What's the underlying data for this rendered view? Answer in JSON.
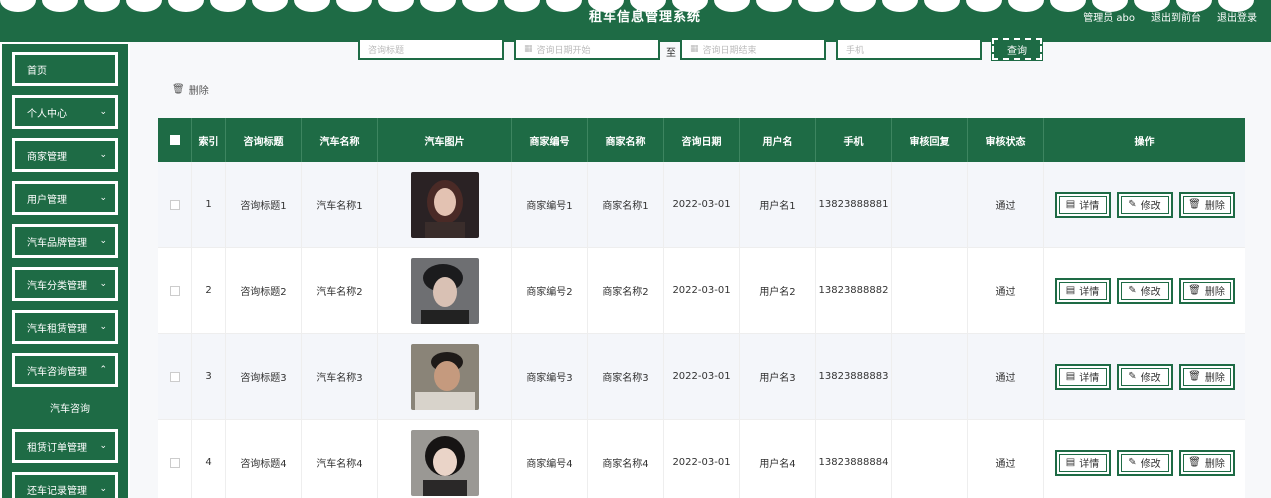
{
  "header": {
    "title": "租车信息管理系统",
    "user": "管理员 abo",
    "exit_front": "退出到前台",
    "logout": "退出登录"
  },
  "sidebar": {
    "items": [
      {
        "label": "首页"
      },
      {
        "label": "个人中心"
      },
      {
        "label": "商家管理"
      },
      {
        "label": "用户管理"
      },
      {
        "label": "汽车品牌管理"
      },
      {
        "label": "汽车分类管理"
      },
      {
        "label": "汽车租赁管理"
      },
      {
        "label": "汽车咨询管理"
      },
      {
        "label": "租赁订单管理"
      },
      {
        "label": "还车记录管理"
      }
    ],
    "submenu": "汽车咨询"
  },
  "search": {
    "title_placeholder": "咨询标题",
    "date_start_placeholder": "咨询日期开始",
    "to": "至",
    "date_end_placeholder": "咨询日期结束",
    "phone_placeholder": "手机",
    "query": "查询"
  },
  "toolbar": {
    "delete": "删除"
  },
  "table": {
    "headers": [
      "索引",
      "咨询标题",
      "汽车名称",
      "汽车图片",
      "商家编号",
      "商家名称",
      "咨询日期",
      "用户名",
      "手机",
      "审核回复",
      "审核状态",
      "操作"
    ],
    "rows": [
      {
        "idx": "1",
        "title": "咨询标题1",
        "car": "汽车名称1",
        "mno": "商家编号1",
        "mname": "商家名称1",
        "date": "2022-03-01",
        "user": "用户名1",
        "phone": "13823888881",
        "reply": "",
        "status": "通过"
      },
      {
        "idx": "2",
        "title": "咨询标题2",
        "car": "汽车名称2",
        "mno": "商家编号2",
        "mname": "商家名称2",
        "date": "2022-03-01",
        "user": "用户名2",
        "phone": "13823888882",
        "reply": "",
        "status": "通过"
      },
      {
        "idx": "3",
        "title": "咨询标题3",
        "car": "汽车名称3",
        "mno": "商家编号3",
        "mname": "商家名称3",
        "date": "2022-03-01",
        "user": "用户名3",
        "phone": "13823888883",
        "reply": "",
        "status": "通过"
      },
      {
        "idx": "4",
        "title": "咨询标题4",
        "car": "汽车名称4",
        "mno": "商家编号4",
        "mname": "商家名称4",
        "date": "2022-03-01",
        "user": "用户名4",
        "phone": "13823888884",
        "reply": "",
        "status": "通过"
      }
    ],
    "op_detail": "详情",
    "op_edit": "修改",
    "op_delete": "删除"
  },
  "colors": {
    "primary": "#1e6b45"
  }
}
